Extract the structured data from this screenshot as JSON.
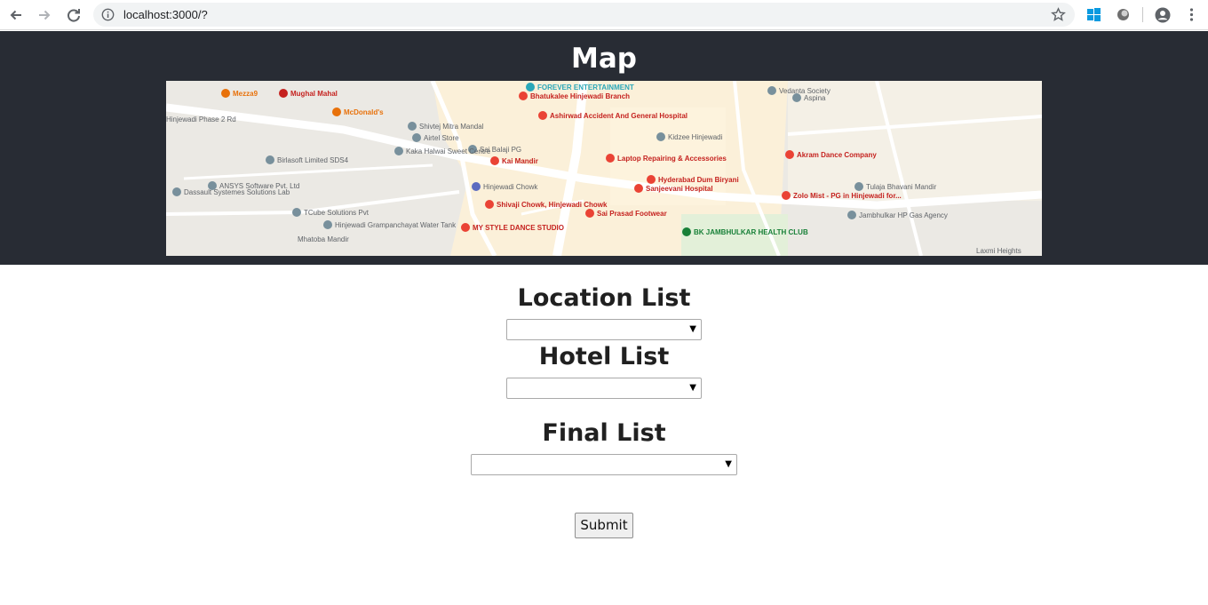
{
  "browser": {
    "url": "localhost:3000/?",
    "icons": [
      "back-arrow-icon",
      "forward-arrow-icon",
      "reload-icon",
      "info-icon",
      "bookmark-star-icon",
      "windows-icon",
      "extension-icon",
      "profile-icon",
      "menu-dots-icon"
    ]
  },
  "header": {
    "title": "Map",
    "background": "#282c34",
    "map_labels": [
      "FOREVER ENTERTAINMENT",
      "Mezza9",
      "Mughal Mahal",
      "McDonald's",
      "Bhatukalee Hinjewadi Branch",
      "Vedanta Society",
      "Aspina",
      "Hinjewadi Phase 2 Rd",
      "Ashirwad Accident And General Hospital",
      "Shivtej Mitra Mandal",
      "Airtel Store",
      "Kidzee Hinjewadi",
      "Kaka Halwai Sweet Centre",
      "Sai Balaji PG",
      "Birlasoft Limited SDS4",
      "Kai Mandir",
      "Laptop Repairing & Accessories",
      "Akram Dance Company",
      "Hyderabad Dum Biryani",
      "ANSYS Software Pvt. Ltd",
      "Hinjewadi Chowk",
      "Sanjeevani Hospital",
      "Zolo Mist - PG in Hinjewadi for...",
      "Tulaja Bhavani Mandir",
      "Dassault Systemes Solutions Lab",
      "Shivaji Chowk, Hinjewadi Chowk",
      "Sai Prasad Footwear",
      "TCube Solutions Pvt",
      "Jambhulkar HP Gas Agency",
      "Hinjewadi Grampanchayat Water Tank",
      "MY STYLE DANCE STUDIO",
      "BK JAMBHULKAR HEALTH CLUB",
      "Mhatoba Mandir",
      "Laxmi Heights"
    ]
  },
  "form": {
    "location_title": "Location List",
    "location_value": "",
    "hotel_title": "Hotel List",
    "hotel_value": "",
    "final_title": "Final List",
    "final_value": "",
    "dropdown_arrow": "▼",
    "submit_label": "Submit"
  }
}
